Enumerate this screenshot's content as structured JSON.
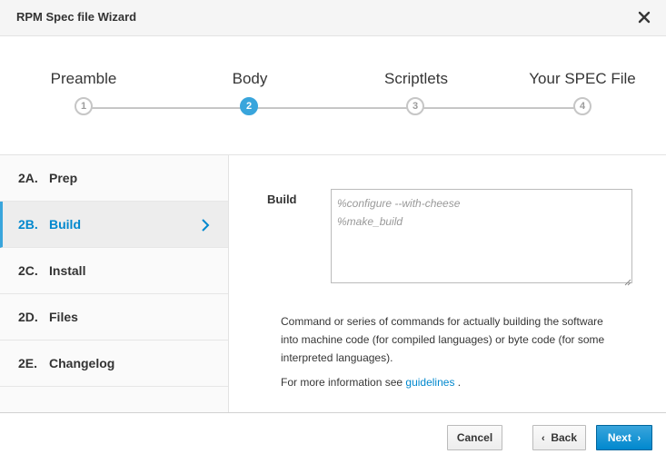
{
  "window": {
    "title": "RPM Spec file Wizard"
  },
  "steps": [
    {
      "label": "Preamble",
      "number": "1",
      "active": false
    },
    {
      "label": "Body",
      "number": "2",
      "active": true
    },
    {
      "label": "Scriptlets",
      "number": "3",
      "active": false
    },
    {
      "label": "Your SPEC File",
      "number": "4",
      "active": false
    }
  ],
  "sidebar": {
    "items": [
      {
        "num": "2A.",
        "name": "Prep"
      },
      {
        "num": "2B.",
        "name": "Build",
        "active": true
      },
      {
        "num": "2C.",
        "name": "Install"
      },
      {
        "num": "2D.",
        "name": "Files"
      },
      {
        "num": "2E.",
        "name": "Changelog"
      }
    ]
  },
  "main": {
    "field_label": "Build",
    "textarea_placeholder": "%configure --with-cheese\n%make_build",
    "help_text": "Command or series of commands for actually building the software into machine code (for compiled languages) or byte code (for some interpreted languages).",
    "more_info_prefix": "For more information see",
    "more_info_link": "guidelines",
    "more_info_suffix": "."
  },
  "footer": {
    "cancel_label": "Cancel",
    "back_label": "Back",
    "next_label": "Next"
  },
  "colors": {
    "accent": "#39a5dc",
    "link": "#0088ce"
  }
}
